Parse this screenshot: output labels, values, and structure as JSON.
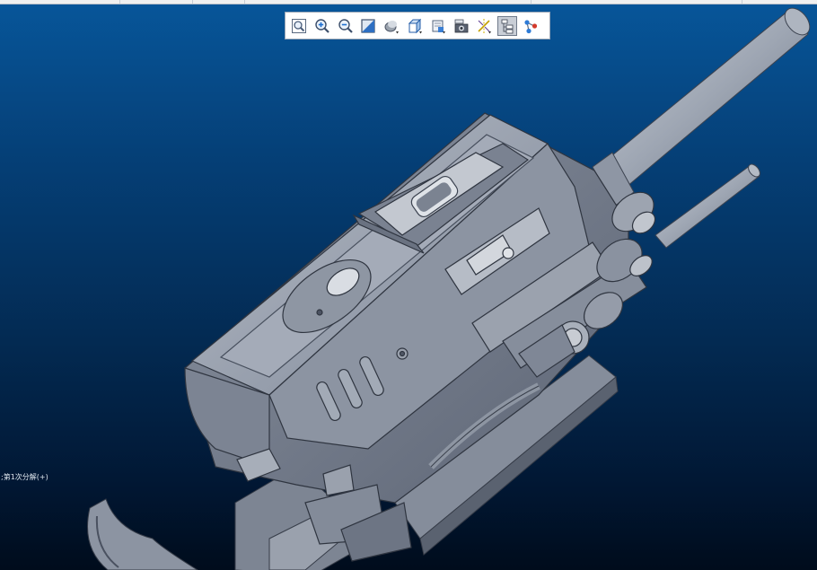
{
  "app": {
    "viewport_background": [
      "#07569a",
      "#000c1c"
    ],
    "model_color": "#9aa2b0"
  },
  "toolbar": {
    "buttons": [
      {
        "name": "zoom-to-fit-icon",
        "active": false
      },
      {
        "name": "zoom-in-icon",
        "active": false
      },
      {
        "name": "zoom-out-icon",
        "active": false
      },
      {
        "name": "view-orientation-icon",
        "active": false
      },
      {
        "name": "display-style-icon",
        "active": false
      },
      {
        "name": "section-view-icon",
        "active": false
      },
      {
        "name": "view-manager-icon",
        "active": false
      },
      {
        "name": "camera-icon",
        "active": false
      },
      {
        "name": "datum-display-icon",
        "active": false
      },
      {
        "name": "model-tree-icon",
        "active": true
      },
      {
        "name": "annotation-icon",
        "active": false
      }
    ]
  },
  "viewport": {
    "feature_label": ";第1次分解(+)"
  }
}
